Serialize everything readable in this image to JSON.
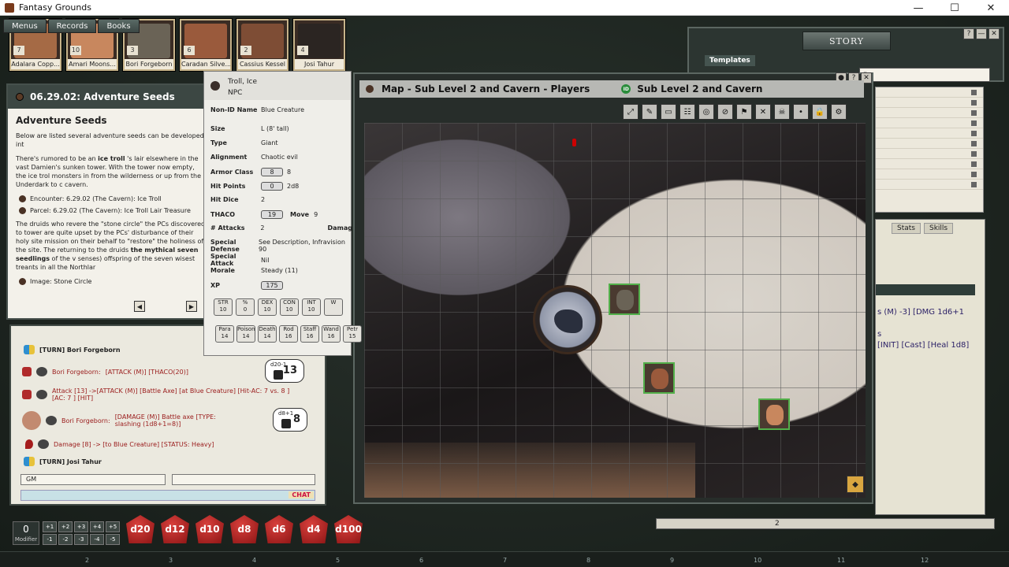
{
  "window": {
    "title": "Fantasy Grounds",
    "min": "—",
    "max": "☐",
    "close": "✕"
  },
  "menu_tabs": [
    "Menus",
    "Records",
    "Books"
  ],
  "portraits": [
    {
      "name": "Adalara Copp...",
      "num": "7",
      "color": "#a56a45"
    },
    {
      "name": "Amari Moons...",
      "num": "10",
      "color": "#c8875e"
    },
    {
      "name": "Bori Forgeborn",
      "num": "3",
      "color": "#6a6356"
    },
    {
      "name": "Caradan Silve...",
      "num": "6",
      "color": "#9a5a3c"
    },
    {
      "name": "Cassius Kessel",
      "num": "2",
      "color": "#7e4d35"
    },
    {
      "name": "Josi Tahur",
      "num": "4",
      "color": "#2b2522"
    }
  ],
  "story": {
    "title": "STORY",
    "templates_tab": "Templates",
    "search_value": "r"
  },
  "adventure": {
    "header": "06.29.02: Adventure Seeds",
    "heading": "Adventure Seeds",
    "intro": "Below are listed several adventure seeds can be developed int",
    "p1_pre": "There's rumored to be an ",
    "p1_bold": "ice troll",
    "p1_post": " 's lair elsewhere in the vast Damien's sunken tower. With the tower now empty, the ice trol monsters in from the wilderness or up from the Underdark to c cavern.",
    "link1": "Encounter: 6.29.02 (The Cavern): Ice Troll",
    "link2": "Parcel: 6.29.02 (The Cavern): Ice Troll Lair Treasure",
    "p2_pre": "The druids who revere the \"stone circle\" the PCs discovered to tower are quite upset by the PCs' disturbance of their holy site mission on their behalf to \"restore\" the holiness of the site. The returning to the druids ",
    "p2_bold": "the mythical seven seedlings",
    "p2_post": " of the v senses) offspring of the seven wisest treants in all the Northlar",
    "link3": "Image: Stone Circle",
    "prev": "◀",
    "next": "▶"
  },
  "npc": {
    "name": "Troll, Ice",
    "type_label": "NPC",
    "nonid_label": "Non-ID Name",
    "nonid_value": "Blue Creature",
    "size_label": "Size",
    "size_value": "L (8' tall)",
    "type2_label": "Type",
    "type2_value": "Giant",
    "align_label": "Alignment",
    "align_value": "Chaotic evil",
    "ac_label": "Armor Class",
    "ac_value": "8",
    "ac_value2": "8",
    "hp_label": "Hit Points",
    "hp_value": "0",
    "hp_value2": "2d8",
    "hd_label": "Hit Dice",
    "hd_value": "2",
    "thaco_label": "THACO",
    "thaco_value": "19",
    "move_label": "Move",
    "move_value": "9",
    "attacks_label": "# Attacks",
    "attacks_value": "2",
    "damage_label": "Damag",
    "sd_label": "Special Defense",
    "sd_value": "See Description, Infravision 90",
    "sa_label": "Special Attack",
    "sa_value": "Nil",
    "morale_label": "Morale",
    "morale_value": "Steady (11)",
    "xp_label": "XP",
    "xp_value": "175",
    "stats": [
      {
        "k": "STR",
        "v": "10"
      },
      {
        "k": "%",
        "v": "0"
      },
      {
        "k": "DEX",
        "v": "10"
      },
      {
        "k": "CON",
        "v": "10"
      },
      {
        "k": "INT",
        "v": "10"
      },
      {
        "k": "W",
        "v": ""
      }
    ],
    "saves": [
      {
        "k": "Para",
        "v": "14"
      },
      {
        "k": "Poison",
        "v": "14"
      },
      {
        "k": "Death",
        "v": "14"
      },
      {
        "k": "Rod",
        "v": "16"
      },
      {
        "k": "Staff",
        "v": "16"
      },
      {
        "k": "Wand",
        "v": "16"
      },
      {
        "k": "Petr",
        "v": "15"
      }
    ]
  },
  "chat": {
    "turn1": "[TURN] Bori Forgeborn",
    "l1_name": "Bori Forgeborn:",
    "l1_text": "[ATTACK (M)]  [THACO(20)]",
    "d1_label": "d20-1",
    "d1_value": "13",
    "l2_text": "Attack [13] ->[ATTACK (M)] [Battle Axe] [at Blue Creature] [Hit-AC: 7 vs. 8 ] [AC: 7 ] [HIT]",
    "l3_name": "Bori Forgeborn:",
    "l3_text": "[DAMAGE (M)] Battle axe [TYPE: slashing (1d8+1=8)]",
    "d2_label": "d8+1",
    "d2_value": "8",
    "l4_text": "Damage [8] -> [to Blue Creature] [STATUS: Heavy]",
    "turn2": "[TURN] Josi Tahur",
    "identity": "GM",
    "mode": "",
    "chat_button": "CHAT"
  },
  "map": {
    "title": "Map - Sub Level 2 and Cavern - Players",
    "subtitle": "Sub Level 2 and Cavern",
    "id_badge": "ID",
    "tools": [
      "⤢",
      "✎",
      "▭",
      "☷",
      "◎",
      "⊘",
      "⚑",
      "✕",
      "☠",
      "•",
      "🔒",
      "⚙"
    ]
  },
  "charsheet": {
    "tab_stats": "Stats",
    "tab_skills": "Skills",
    "line1": "s (M) -3] [DMG 1d6+1",
    "line2": "s",
    "line3": "[INIT] [Cast] [Heal 1d8]"
  },
  "bottom": {
    "modifier_value": "0",
    "modifier_label": "Modifier",
    "mod_buttons": [
      "+1",
      "+2",
      "+3",
      "+4",
      "+5",
      "-1",
      "-2",
      "-3",
      "-4",
      "-5"
    ],
    "dice": [
      "d20",
      "d12",
      "d10",
      "d8",
      "d6",
      "d4",
      "d100"
    ],
    "hotkeys": [
      "2",
      "3",
      "4",
      "5",
      "6",
      "7",
      "8",
      "9",
      "10",
      "11",
      "12"
    ],
    "round": "2"
  }
}
